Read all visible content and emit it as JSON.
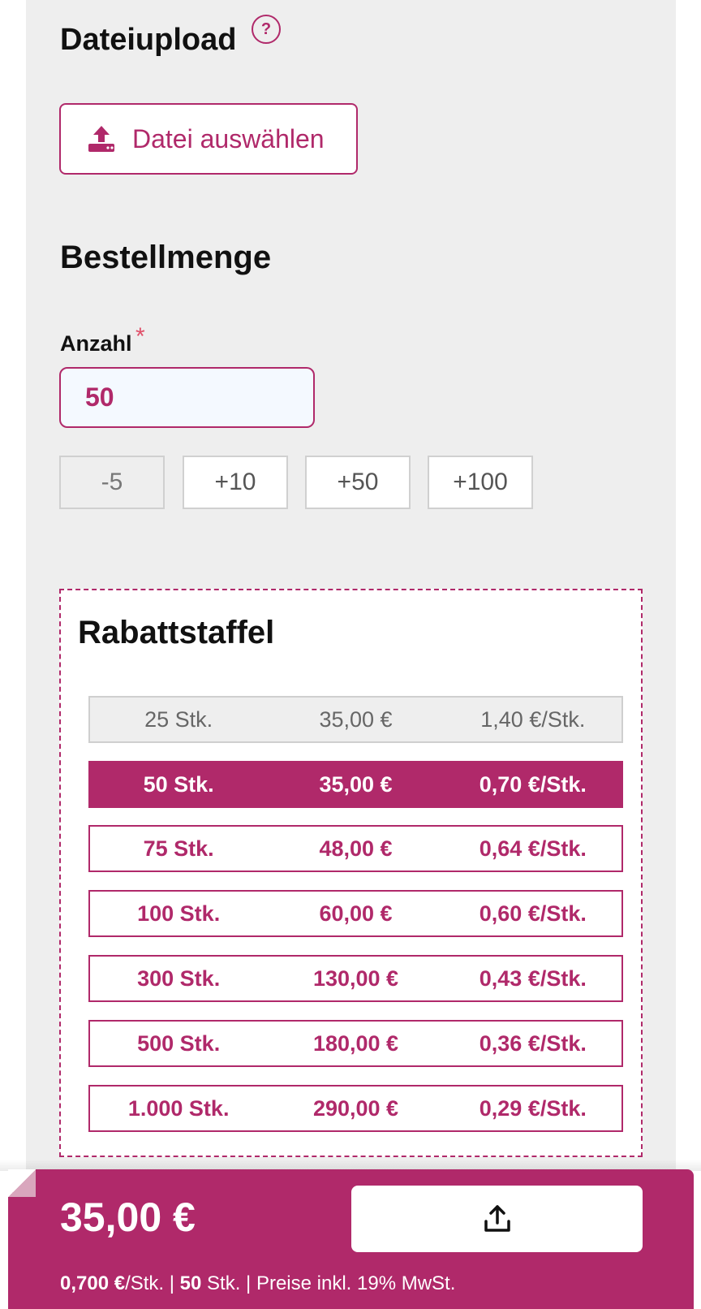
{
  "upload": {
    "title": "Dateiupload",
    "help": "?",
    "button_label": "Datei auswählen"
  },
  "order": {
    "title": "Bestellmenge",
    "quantity_label": "Anzahl",
    "required_mark": "*",
    "quantity_value": "50",
    "steps": [
      {
        "label": "-5",
        "enabled": false
      },
      {
        "label": "+10",
        "enabled": true
      },
      {
        "label": "+50",
        "enabled": true
      },
      {
        "label": "+100",
        "enabled": true
      }
    ]
  },
  "discount": {
    "title": "Rabattstaffel",
    "tiers": [
      {
        "qty": "25 Stk.",
        "price": "35,00 €",
        "unit": "1,40 €/Stk.",
        "state": "past"
      },
      {
        "qty": "50 Stk.",
        "price": "35,00 €",
        "unit": "0,70 €/Stk.",
        "state": "active"
      },
      {
        "qty": "75 Stk.",
        "price": "48,00 €",
        "unit": "0,64 €/Stk.",
        "state": "normal"
      },
      {
        "qty": "100 Stk.",
        "price": "60,00 €",
        "unit": "0,60 €/Stk.",
        "state": "normal"
      },
      {
        "qty": "300 Stk.",
        "price": "130,00 €",
        "unit": "0,43 €/Stk.",
        "state": "normal"
      },
      {
        "qty": "500 Stk.",
        "price": "180,00 €",
        "unit": "0,36 €/Stk.",
        "state": "normal"
      },
      {
        "qty": "1.000 Stk.",
        "price": "290,00 €",
        "unit": "0,29 €/Stk.",
        "state": "normal"
      }
    ]
  },
  "footer": {
    "total_price": "35,00 €",
    "unit_price": "0,700 €",
    "unit_suffix": "/Stk. | ",
    "quantity": "50",
    "quantity_suffix": " Stk. | Preise inkl. 19% MwSt.",
    "cta_icon": "upload-icon"
  },
  "colors": {
    "accent": "#b0296a",
    "panel_bg": "#eeeeee",
    "input_bg": "#f4f9ff",
    "required": "#e0506a"
  }
}
